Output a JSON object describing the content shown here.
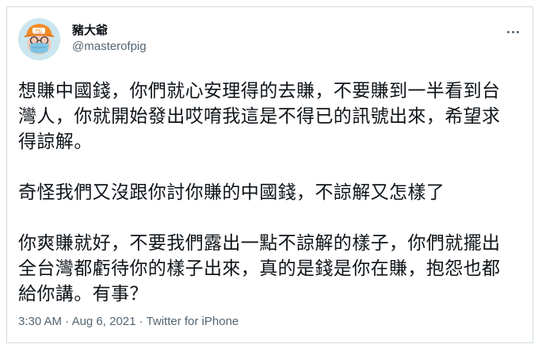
{
  "user": {
    "display_name": "豬大爺",
    "username": "@masterofpig"
  },
  "tweet": {
    "paragraphs": [
      "想賺中國錢，你們就心安理得的去賺，不要賺到一半看到台灣人，你就開始發出哎唷我這是不得已的訊號出來，希望求得諒解。",
      "奇怪我們又沒跟你討你賺的中國錢，不諒解又怎樣了",
      "你爽賺就好，不要我們露出一點不諒解的樣子，你們就擺出全台灣都虧待你的樣子出來，真的是錢是你在賺，抱怨也都給你講。有事？"
    ]
  },
  "meta": {
    "time": "3:30 AM",
    "date": "Aug 6, 2021",
    "separator": " · ",
    "source": "Twitter for iPhone"
  },
  "icons": {
    "more": "more-horizontal-icon",
    "avatar": "pig-cartoon-avatar"
  },
  "colors": {
    "text_primary": "#0f1419",
    "text_secondary": "#536471",
    "border": "#cfd9de"
  }
}
